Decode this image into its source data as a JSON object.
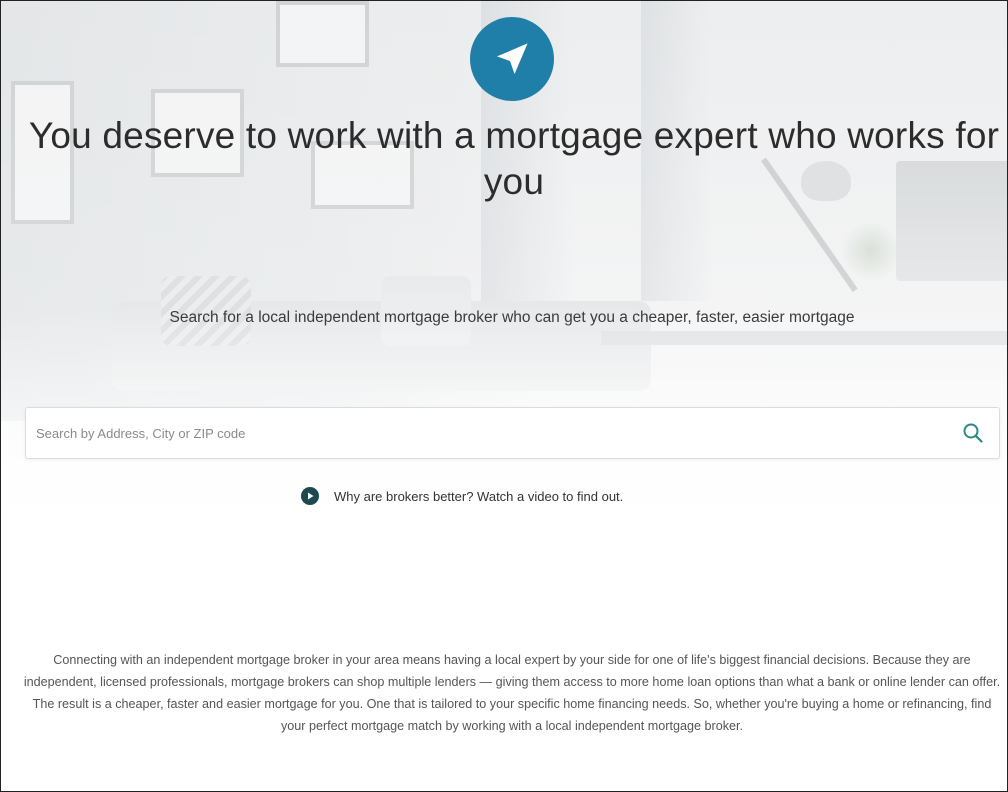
{
  "hero": {
    "logo_icon": "navigation-arrow-icon",
    "accent_color": "#1f7fa8",
    "headline": "You deserve to work with a mortgage expert who works for you",
    "subheadline": "Search for a local independent mortgage broker who can get you a cheaper, faster, easier mortgage"
  },
  "search": {
    "placeholder": "Search by Address, City or ZIP code",
    "value": "",
    "icon": "search-icon",
    "icon_color": "#2a8a86"
  },
  "video": {
    "icon": "play-icon",
    "label": "Why are brokers better? Watch a video to find out."
  },
  "description": {
    "text": "Connecting with an independent mortgage broker in your area means having a local expert by your side for one of life's biggest financial decisions. Because they are independent, licensed professionals, mortgage brokers can shop multiple lenders — giving them access to more home loan options than what a bank or online lender can offer. The result is a cheaper, faster and easier mortgage for you. One that is tailored to your specific home financing needs. So, whether you're buying a home or refinancing, find your perfect mortgage match by working with a local independent mortgage broker."
  }
}
